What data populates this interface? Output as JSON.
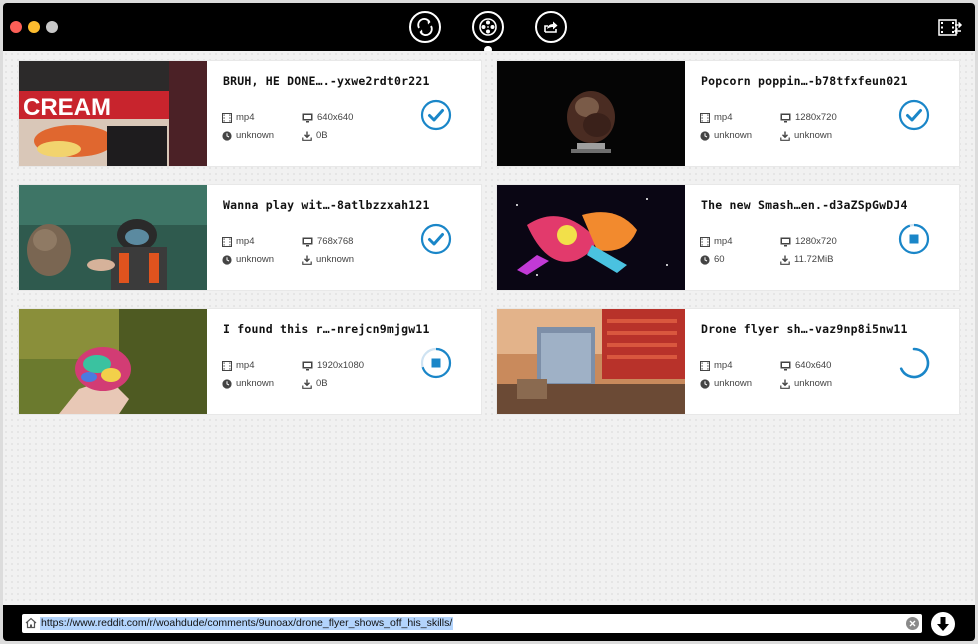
{
  "window": {
    "controls": [
      "close",
      "minimize",
      "zoom"
    ]
  },
  "toolbar": {
    "buttons": [
      {
        "id": "refresh",
        "icon": "refresh-icon"
      },
      {
        "id": "downloads",
        "icon": "film-reel-icon",
        "active": true
      },
      {
        "id": "share",
        "icon": "share-icon"
      }
    ],
    "right_icon": "film-convert-icon"
  },
  "downloads": [
    {
      "title": "BRUH, HE DONE….-yxwe2rdt0r221",
      "format": "mp4",
      "resolution": "640x640",
      "duration": "unknown",
      "size": "0B",
      "status": "done",
      "status_icon": "check-circle-icon"
    },
    {
      "title": "Popcorn poppin…-b78tfxfeun021",
      "format": "mp4",
      "resolution": "1280x720",
      "duration": "unknown",
      "size": "unknown",
      "status": "done",
      "status_icon": "check-circle-icon"
    },
    {
      "title": "Wanna play wit…-8atlbzzxah121",
      "format": "mp4",
      "resolution": "768x768",
      "duration": "unknown",
      "size": "unknown",
      "status": "done",
      "status_icon": "check-circle-icon"
    },
    {
      "title": "The new Smash…en.-d3aZSpGwDJ4",
      "format": "mp4",
      "resolution": "1280x720",
      "duration": "60",
      "size": "11.72MiB",
      "status": "downloading",
      "progress": 0.95,
      "status_icon": "stop-progress-icon"
    },
    {
      "title": "I found this r…-nrejcn9mjgw11",
      "format": "mp4",
      "resolution": "1920x1080",
      "duration": "unknown",
      "size": "0B",
      "status": "downloading",
      "progress": 0.7,
      "status_icon": "stop-progress-icon"
    },
    {
      "title": "Drone flyer sh…-vaz9np8i5nw11",
      "format": "mp4",
      "resolution": "640x640",
      "duration": "unknown",
      "size": "unknown",
      "status": "loading",
      "status_icon": "spinner-icon"
    }
  ],
  "url_bar": {
    "value": "https://www.reddit.com/r/woahdude/comments/9unoax/drone_flyer_shows_off_his_skills/"
  },
  "colors": {
    "accent": "#1a86c8",
    "titlebar": "#000000",
    "background": "#f1f1f1"
  }
}
